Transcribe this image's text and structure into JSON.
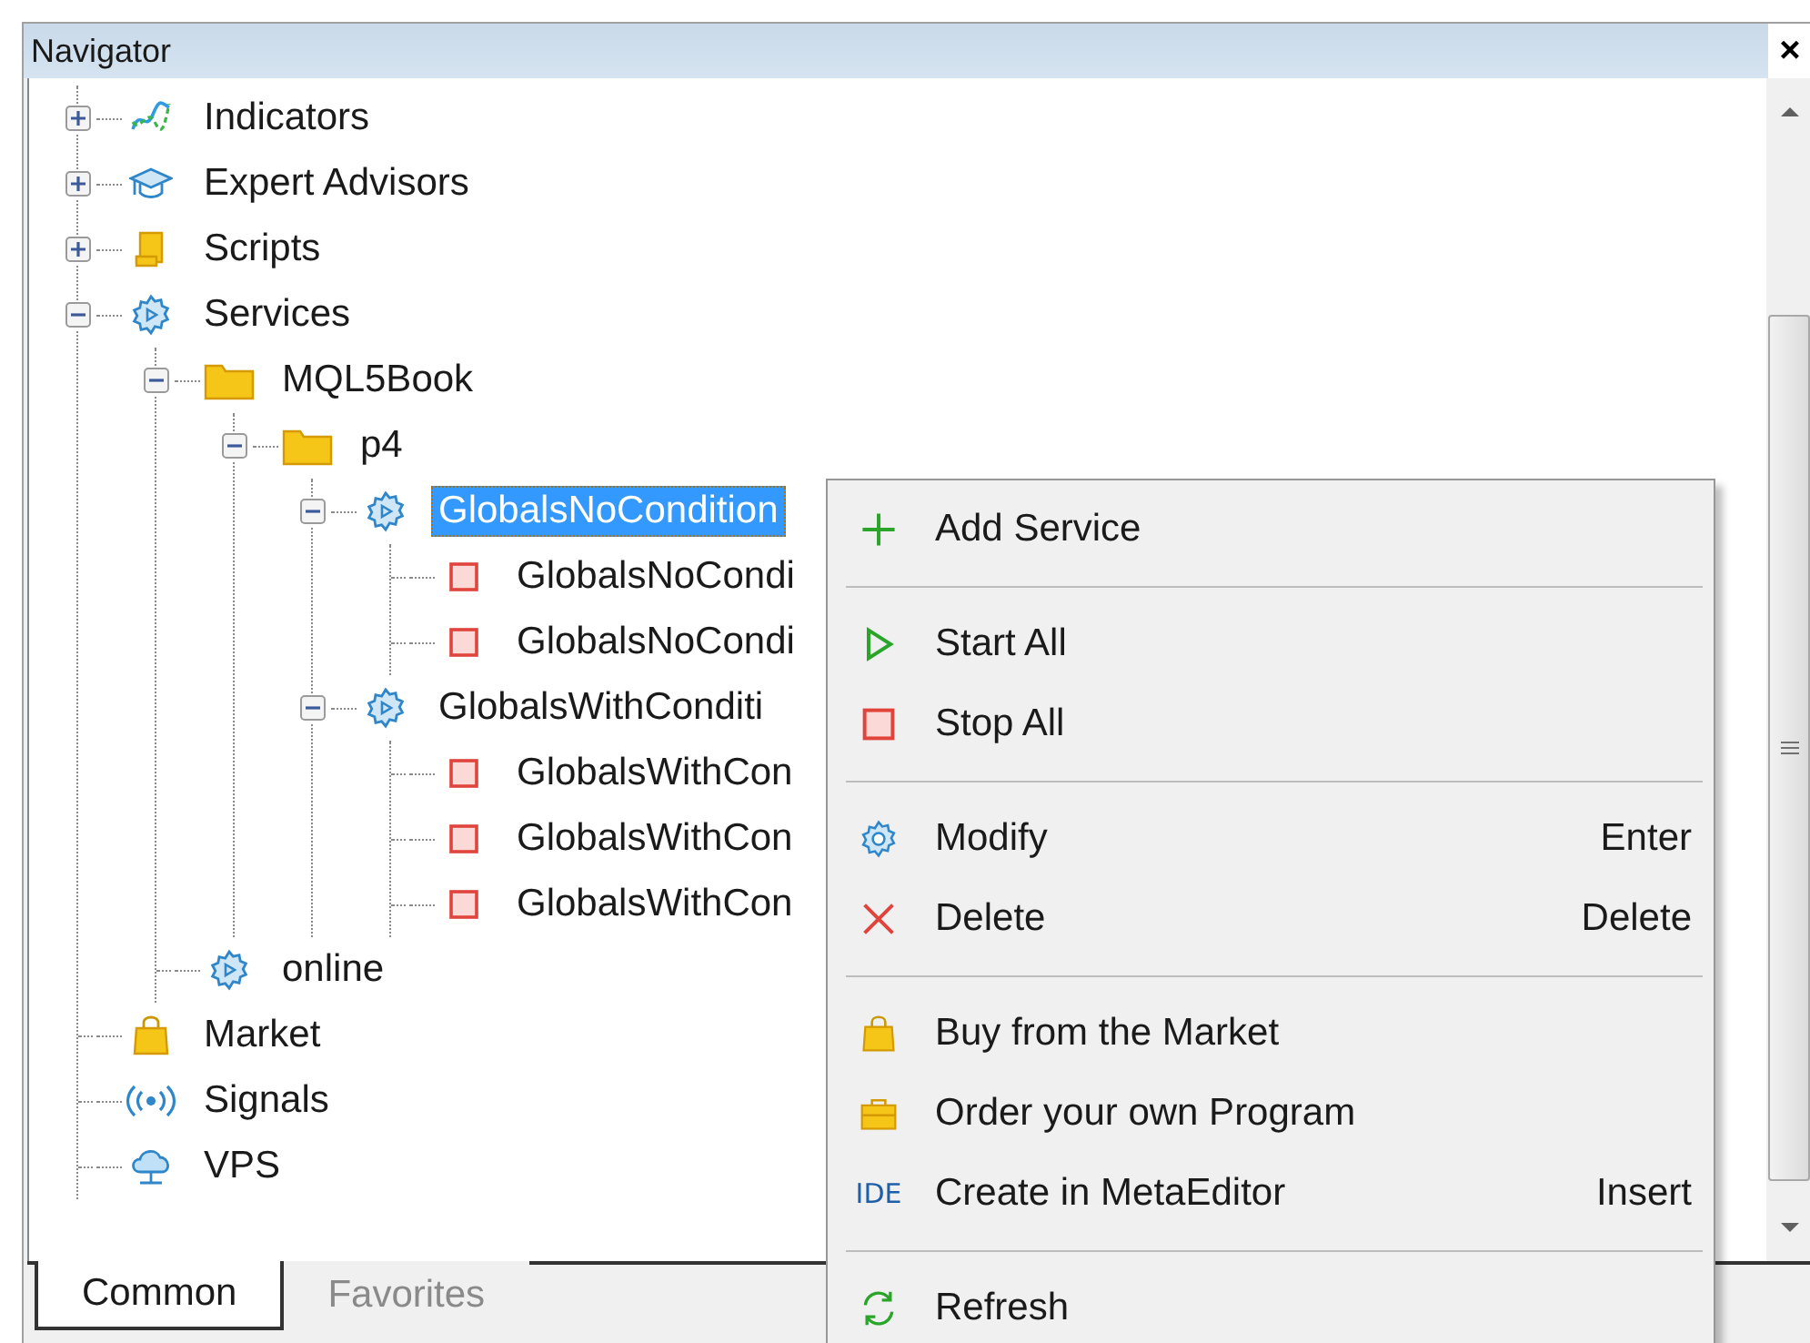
{
  "panel": {
    "title": "Navigator",
    "close": "×"
  },
  "tree": [
    {
      "label": "Indicators",
      "kind": "indicators",
      "expanded": false,
      "selected": false
    },
    {
      "label": "Expert Advisors",
      "kind": "experts",
      "expanded": false,
      "selected": false
    },
    {
      "label": "Scripts",
      "kind": "scripts",
      "expanded": false,
      "selected": false
    },
    {
      "label": "Services",
      "kind": "services",
      "expanded": true,
      "selected": false,
      "children": [
        {
          "label": "MQL5Book",
          "kind": "folder",
          "expanded": true,
          "selected": false,
          "children": [
            {
              "label": "p4",
              "kind": "folder",
              "expanded": true,
              "selected": false,
              "children": [
                {
                  "label": "GlobalsNoCondition",
                  "kind": "service",
                  "expanded": true,
                  "selected": true,
                  "children": [
                    {
                      "label": "GlobalsNoCondi",
                      "kind": "program",
                      "running": false,
                      "selected": false
                    },
                    {
                      "label": "GlobalsNoCondi",
                      "kind": "program",
                      "running": false,
                      "selected": false
                    }
                  ]
                },
                {
                  "label": "GlobalsWithConditi",
                  "kind": "service",
                  "expanded": true,
                  "selected": false,
                  "children": [
                    {
                      "label": "GlobalsWithCon",
                      "kind": "program",
                      "running": false,
                      "selected": false
                    },
                    {
                      "label": "GlobalsWithCon",
                      "kind": "program",
                      "running": false,
                      "selected": false
                    },
                    {
                      "label": "GlobalsWithCon",
                      "kind": "program",
                      "running": false,
                      "selected": false
                    }
                  ]
                }
              ]
            }
          ]
        },
        {
          "label": "online",
          "kind": "service",
          "selected": false
        }
      ]
    },
    {
      "label": "Market",
      "kind": "market",
      "selected": false
    },
    {
      "label": "Signals",
      "kind": "signals",
      "selected": false
    },
    {
      "label": "VPS",
      "kind": "vps",
      "selected": false
    }
  ],
  "tabs": [
    {
      "label": "Common",
      "selected": true
    },
    {
      "label": "Favorites",
      "selected": false
    }
  ],
  "context_menu": [
    {
      "kind": "add",
      "label": "Add Service"
    },
    {
      "kind": "separator"
    },
    {
      "kind": "start",
      "label": "Start All"
    },
    {
      "kind": "stop",
      "label": "Stop All"
    },
    {
      "kind": "separator"
    },
    {
      "kind": "modify",
      "label": "Modify",
      "shortcut": "Enter"
    },
    {
      "kind": "delete",
      "label": "Delete",
      "shortcut": "Delete"
    },
    {
      "kind": "separator"
    },
    {
      "kind": "buy",
      "label": "Buy from the Market"
    },
    {
      "kind": "order",
      "label": "Order your own Program"
    },
    {
      "kind": "create",
      "label": "Create in MetaEditor",
      "shortcut": "Insert",
      "icon_text": "IDE"
    },
    {
      "kind": "separator"
    },
    {
      "kind": "refresh",
      "label": "Refresh"
    }
  ]
}
